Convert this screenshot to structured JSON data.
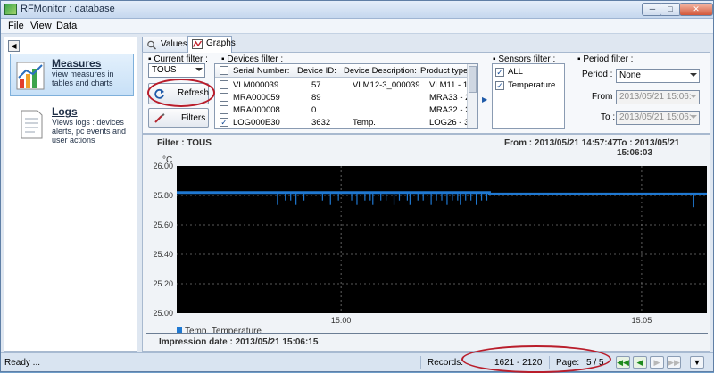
{
  "window": {
    "title": "RFMonitor : database",
    "buttons": [
      "minimize",
      "maximize",
      "close"
    ]
  },
  "menu": [
    "File",
    "View",
    "Data"
  ],
  "nav": {
    "items": [
      {
        "title": "Measures",
        "desc": "view measures in tables and charts",
        "icon": "chart-icon"
      },
      {
        "title": "Logs",
        "desc": "Views logs : devices alerts, pc events and user actions",
        "icon": "document-icon"
      }
    ]
  },
  "tabs": [
    {
      "label": "Values",
      "icon": "magnifier-icon"
    },
    {
      "label": "Graphs",
      "icon": "graph-icon"
    }
  ],
  "filters": {
    "current": {
      "title": "Current filter :",
      "value": "TOUS"
    },
    "refresh_label": "Refresh",
    "filters_label": "Filters",
    "devices": {
      "title": "Devices filter :",
      "columns": [
        "Serial Number:",
        "Device ID:",
        "Device Description:",
        "Product type:"
      ],
      "rows": [
        {
          "checked": false,
          "serial": "VLM000039",
          "id": "57",
          "desc": "VLM12-3_000039",
          "type": "VLM11 - 1"
        },
        {
          "checked": false,
          "serial": "MRA000059",
          "id": "89",
          "desc": "",
          "type": "MRA33 - 2"
        },
        {
          "checked": false,
          "serial": "MRA000008",
          "id": "0",
          "desc": "",
          "type": "MRA32 - 2"
        },
        {
          "checked": true,
          "serial": "LOG000E30",
          "id": "3632",
          "desc": "Temp.",
          "type": "LOG26 - 3"
        }
      ]
    },
    "sensors": {
      "title": "Sensors filter :",
      "items": [
        {
          "label": "ALL",
          "checked": true
        },
        {
          "label": "Temperature",
          "checked": true
        }
      ]
    },
    "period": {
      "title": "Period filter :",
      "period_label": "Period :",
      "period_value": "None",
      "from_label": "From :",
      "from_value": "2013/05/21 15:06:",
      "to_label": "To :",
      "to_value": "2013/05/21 15:06:"
    }
  },
  "graph": {
    "filter_text": "Filter : TOUS",
    "from_text": "From : 2013/05/21 14:57:47",
    "to_text": "To : 2013/05/21 15:06:03",
    "impression": "Impression date : 2013/05/21 15:06:15"
  },
  "chart_data": {
    "type": "line",
    "ylabel": "°C",
    "ylim": [
      25.0,
      26.0
    ],
    "yticks": [
      "26.00",
      "25.80",
      "25.60",
      "25.40",
      "25.20",
      "25.00"
    ],
    "xticks": [
      "15:00",
      "15:05"
    ],
    "grid": true,
    "legend_position": "bottom-left",
    "series": [
      {
        "name": "Temp. Temperature",
        "color": "#1f78d1",
        "baseline": 25.81,
        "values": [
          25.82,
          25.81,
          25.81,
          25.81,
          25.72,
          25.81
        ]
      }
    ]
  },
  "status": {
    "ready": "Ready ...",
    "records_label": "Records:",
    "records_value": "1621 - 2120",
    "page_label": "Page:",
    "page_value": "5 / 5"
  },
  "colors": {
    "accent": "#1f78d1",
    "highlight": "#b91d2b"
  }
}
